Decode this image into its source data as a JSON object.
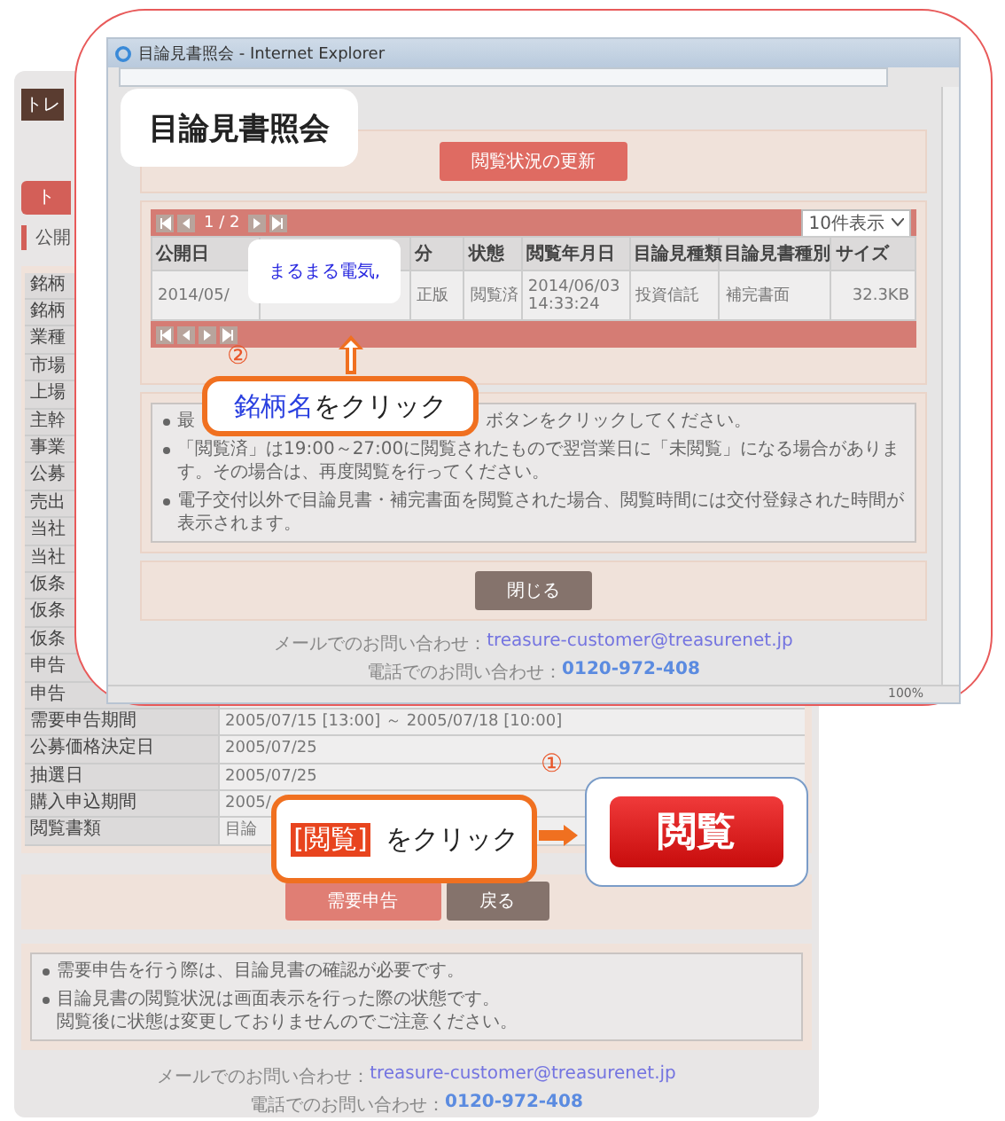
{
  "page": {
    "logo": "トレ",
    "nav_button": "ト",
    "section_title": "公開",
    "details": [
      {
        "label": "銘柄"
      },
      {
        "label": "銘柄"
      },
      {
        "label": "業種"
      },
      {
        "label": "市場"
      },
      {
        "label": "上場"
      },
      {
        "label": "主幹"
      },
      {
        "label": "事業"
      },
      {
        "label": "公募"
      },
      {
        "label": "売出"
      },
      {
        "label": "当社"
      },
      {
        "label": "当社"
      },
      {
        "label": "仮条"
      },
      {
        "label": "仮条"
      },
      {
        "label": "仮条"
      },
      {
        "label": "申告"
      },
      {
        "label": "申告"
      },
      {
        "label": "需要申告期間",
        "value": "2005/07/15 [13:00] ～ 2005/07/18 [10:00]"
      },
      {
        "label": "公募価格決定日",
        "value": "2005/07/25"
      },
      {
        "label": "抽選日",
        "value": "2005/07/25"
      },
      {
        "label": "購入申込期間",
        "value": "2005/"
      },
      {
        "label": "閲覧書類",
        "value": "目論"
      }
    ],
    "buttons": [
      {
        "label": "需要申告",
        "kind": "primary"
      },
      {
        "label": "戻る",
        "kind": "secondary"
      }
    ],
    "notes": [
      {
        "lines": [
          "需要申告を行う際は、目論見書の確認が必要です。"
        ]
      },
      {
        "lines": [
          "目論見書の閲覧状況は画面表示を行った際の状態です。",
          "閲覧後に状態は変更しておりませんのでご注意ください。"
        ]
      }
    ],
    "footer": {
      "mail_label": "メールでのお問い合わせ：",
      "mail": "treasure-customer@treasurenet.jp",
      "phone_label": "電話でのお問い合わせ：",
      "phone": "0120-972-408"
    }
  },
  "popup": {
    "window_title": "目論見書照会 - Internet Explorer",
    "caption": "目論見書照会",
    "refresh_button": "閲覧状況の更新",
    "pager": "1 / 2",
    "page_size": "10件表示",
    "columns": [
      {
        "label": "公開日"
      },
      {},
      {
        "label": "分"
      },
      {
        "label": "状態"
      },
      {
        "label": "閲覧年月日"
      },
      {
        "label": "目論見種類"
      },
      {
        "label": "目論見書種別"
      },
      {
        "label": "サイズ"
      }
    ],
    "rows": [
      {
        "cells": [
          {
            "text": "2014/05/"
          },
          {},
          {
            "text": "正版"
          },
          {
            "text": "閲覧済"
          },
          {
            "lines": [
              "2014/06/03",
              "14:33:24"
            ]
          },
          {
            "text": "投資信託"
          },
          {
            "text": "補完書面"
          },
          {
            "text": "32.3KB"
          }
        ]
      }
    ],
    "link_bubble": "まるまる電気,",
    "step": "②",
    "callout_highlight": "銘柄名",
    "callout_text": "をクリック",
    "notes": [
      {
        "parts": [
          "最",
          "ボタンをクリックしてください。"
        ]
      },
      {
        "parts": [
          "「閲覧済」は19:00～27:00に閲覧されたもので翌営業日に「未閲覧」になる場合があります。その場合は、再度閲覧を行ってください。"
        ]
      },
      {
        "parts": [
          "電子交付以外で目論見書・補完書面を閲覧された場合、閲覧時間には交付登録された時間が表示されます。"
        ]
      }
    ],
    "close_button": "閉じる",
    "footer": {
      "mail_label": "メールでのお問い合わせ：",
      "mail": "treasure-customer@treasurenet.jp",
      "phone_label": "電話でのお問い合わせ：",
      "phone": "0120-972-408"
    },
    "zoom": "100%"
  },
  "step1": {
    "number": "①",
    "highlight": "[閲覧]",
    "text": "をクリック",
    "button": "閲覧"
  }
}
